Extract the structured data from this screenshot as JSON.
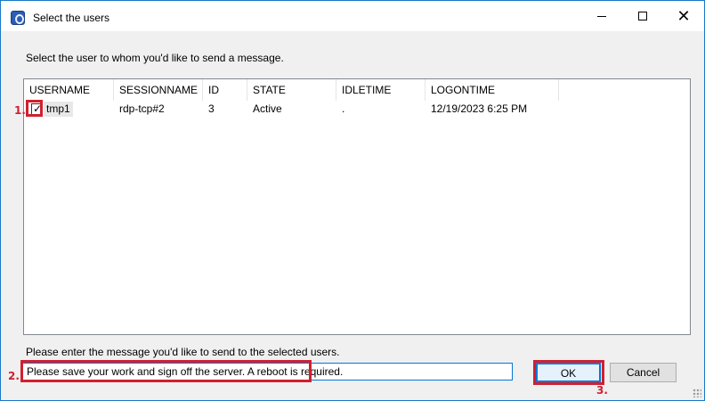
{
  "window": {
    "title": "Select the users",
    "icon": "app-icon",
    "controls": {
      "minimize": "minimize-icon",
      "maximize": "maximize-icon",
      "close": "✕"
    }
  },
  "prompt_users": "Select the user to whom you'd like to send a message.",
  "list": {
    "columns": [
      "USERNAME",
      "SESSIONNAME",
      "ID",
      "STATE",
      "IDLETIME",
      "LOGONTIME"
    ],
    "rows": [
      {
        "checked": true,
        "username": "tmp1",
        "sessionname": "rdp-tcp#2",
        "id": "3",
        "state": "Active",
        "idletime": ".",
        "logontime": "12/19/2023 6:25 PM"
      }
    ]
  },
  "prompt_message": "Please enter the message you'd like to send to the selected users.",
  "message_input": {
    "value": "Please save your work and sign off the server. A reboot is required."
  },
  "buttons": {
    "ok": "OK",
    "cancel": "Cancel"
  },
  "annotations": {
    "step1": "1.",
    "step2": "2.",
    "step3": "3.",
    "color": "#d02030"
  }
}
